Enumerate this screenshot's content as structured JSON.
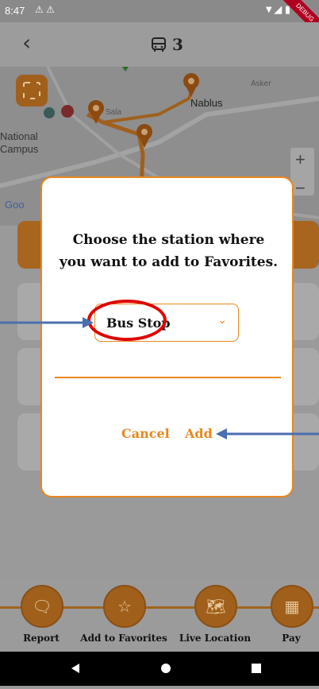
{
  "status_bar": {
    "time": "8:47",
    "warning_icons": "⚠ ⚠",
    "signal": "▼◢ ▮",
    "debug_banner": "DEBUG"
  },
  "header": {
    "back_icon": "chevron-left-icon",
    "route_number": "3",
    "route_icon": "bus-icon"
  },
  "map": {
    "labels": {
      "city": "Nablus",
      "campus_line1": "National",
      "campus_line2": "Campus",
      "google": "Goo",
      "street": "Asker",
      "street2": "Sala"
    },
    "zoom_in": "+",
    "zoom_out": "−"
  },
  "dialog": {
    "message": "Choose the station where you want to add to Favorites.",
    "dropdown": {
      "selected": "Bus Stop"
    },
    "cancel_label": "Cancel",
    "add_label": "Add"
  },
  "bottom_bar": {
    "items": [
      {
        "label": "Report",
        "icon": "report-icon"
      },
      {
        "label": "Add to Favorites",
        "icon": "star-icon"
      },
      {
        "label": "Live Location",
        "icon": "map-pin-icon"
      },
      {
        "label": "Pay",
        "icon": "qr-code-icon"
      }
    ]
  },
  "colors": {
    "accent": "#e8871e",
    "annotation_red": "#e00000",
    "annotation_blue": "#4a6fb0"
  }
}
